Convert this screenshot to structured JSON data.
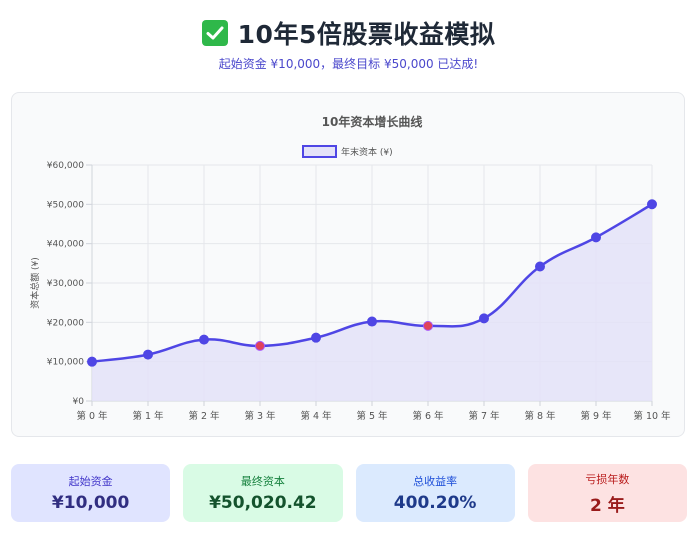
{
  "header": {
    "title": "10年5倍股票收益模拟",
    "subtitle": "起始资金 ¥10,000，最终目标 ¥50,000 已达成!"
  },
  "colors": {
    "line": "#4f46e5",
    "fill": "#e4e2f8",
    "point": "#4f46e5",
    "loss_point": "#e0435a",
    "check": "#2fb84a"
  },
  "icons": {
    "title_icon": "check-mark-icon"
  },
  "chart_data": {
    "type": "line",
    "title": "10年资本增长曲线",
    "ylabel": "资本总额 (¥)",
    "xlabel": "",
    "categories": [
      "第 0 年",
      "第 1 年",
      "第 2 年",
      "第 3 年",
      "第 4 年",
      "第 5 年",
      "第 6 年",
      "第 7 年",
      "第 8 年",
      "第 9 年",
      "第 10 年"
    ],
    "ylim": [
      0,
      60000
    ],
    "yticks": [
      0,
      10000,
      20000,
      30000,
      40000,
      50000,
      60000
    ],
    "ytick_labels": [
      "¥0",
      "¥10,000",
      "¥20,000",
      "¥30,000",
      "¥40,000",
      "¥50,000",
      "¥60,000"
    ],
    "grid": true,
    "legend_position": "top-center",
    "series": [
      {
        "name": "年末资本 (¥)",
        "values": [
          10000,
          11800,
          15600,
          14000,
          16100,
          20200,
          19100,
          21000,
          34200,
          41600,
          50020.42
        ],
        "loss_years": [
          3,
          6
        ],
        "fill": true
      }
    ]
  },
  "stats": [
    {
      "label": "起始资金",
      "value": "¥10,000"
    },
    {
      "label": "最终资本",
      "value": "¥50,020.42"
    },
    {
      "label": "总收益率",
      "value": "400.20%"
    },
    {
      "label": "亏损年数",
      "value": "2 年"
    }
  ]
}
